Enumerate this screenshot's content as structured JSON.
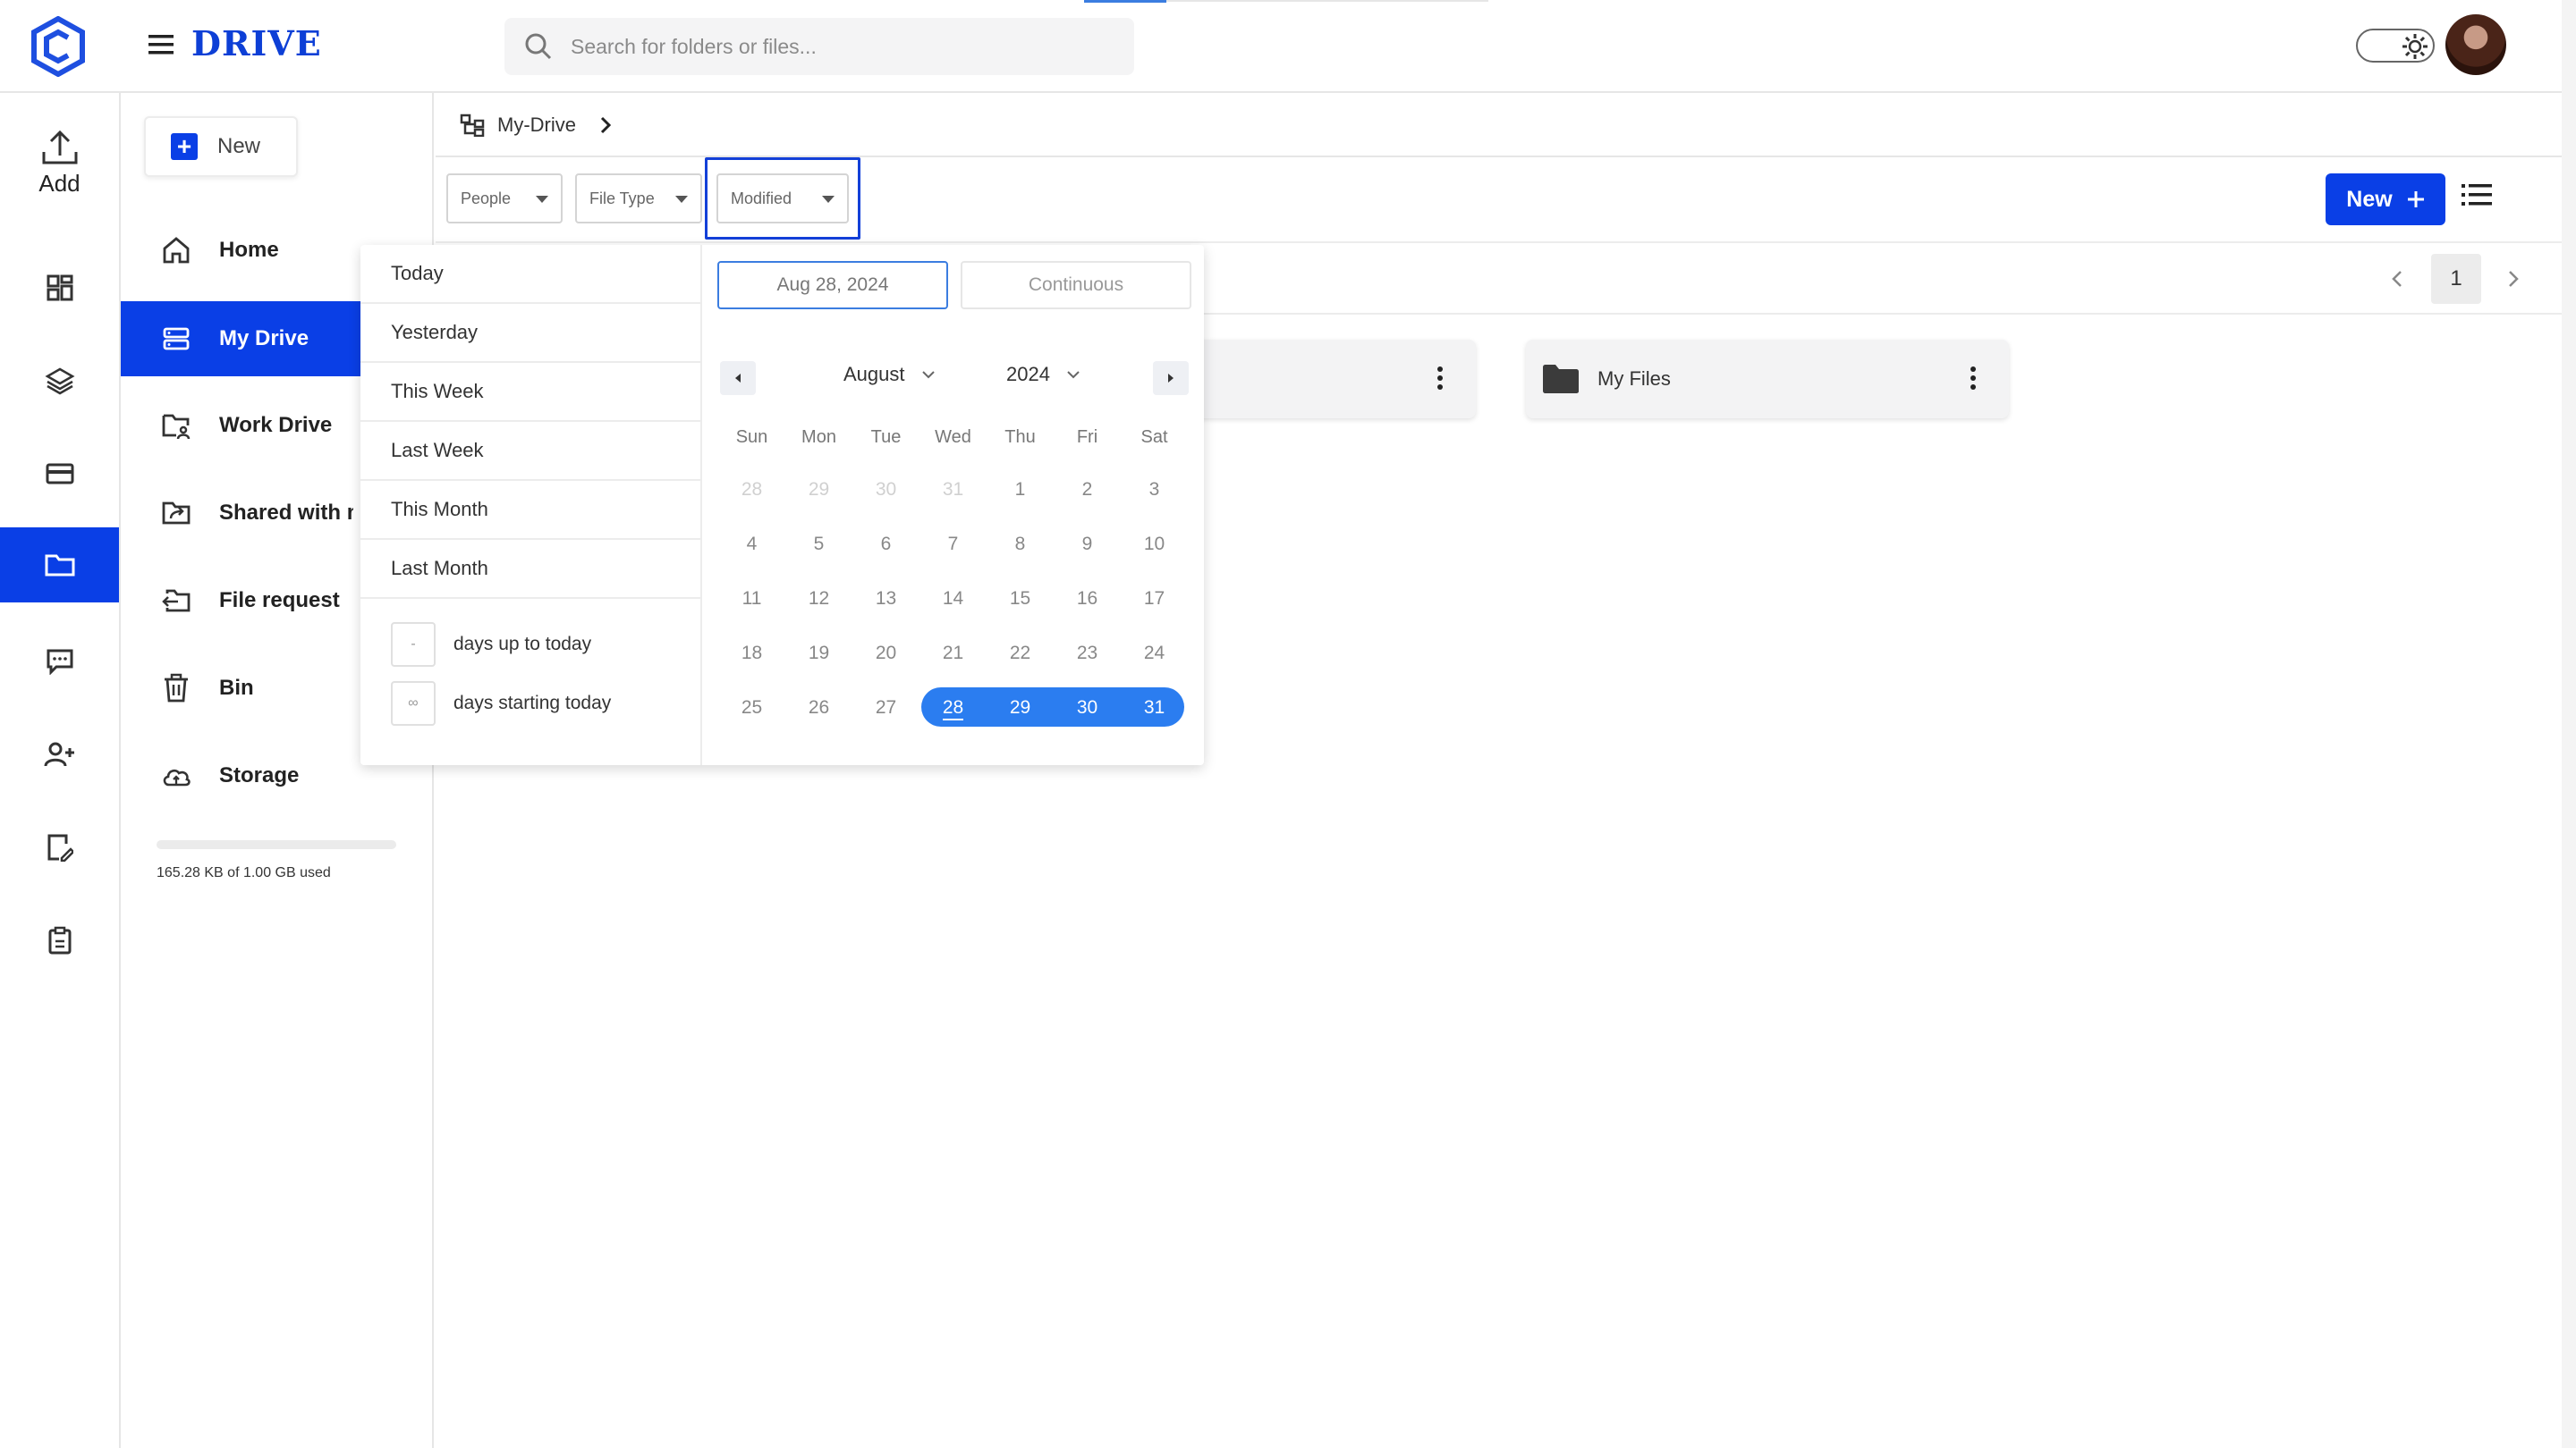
{
  "app": {
    "brand": "DRIVE"
  },
  "search": {
    "placeholder": "Search for folders or files..."
  },
  "rail": {
    "add_label": "Add"
  },
  "sidebar": {
    "new_label": "New",
    "items": [
      {
        "label": "Home"
      },
      {
        "label": "My Drive"
      },
      {
        "label": "Work Drive"
      },
      {
        "label": "Shared with me"
      },
      {
        "label": "File request"
      },
      {
        "label": "Bin"
      },
      {
        "label": "Storage"
      }
    ],
    "storage_text": "165.28 KB of 1.00 GB used",
    "storage_used_fraction": 0.0002
  },
  "breadcrumb": {
    "label": "My-Drive"
  },
  "filters": {
    "people": "People",
    "file_type": "File Type",
    "modified": "Modified"
  },
  "toolbar": {
    "new_label": "New"
  },
  "pagination": {
    "current": "1"
  },
  "folders": [
    {
      "name": ""
    },
    {
      "name": "My Files"
    }
  ],
  "date_filter": {
    "quick_options": [
      "Today",
      "Yesterday",
      "This Week",
      "Last Week",
      "This Month",
      "Last Month"
    ],
    "days_up_to_today": {
      "value": "-",
      "label": "days up to today"
    },
    "days_starting_today": {
      "value": "∞",
      "label": "days starting today"
    },
    "start_date": "Aug 28, 2024",
    "end_date": "Continuous",
    "month": "August",
    "year": "2024",
    "weekdays": [
      "Sun",
      "Mon",
      "Tue",
      "Wed",
      "Thu",
      "Fri",
      "Sat"
    ],
    "weeks": [
      [
        "28",
        "29",
        "30",
        "31",
        "1",
        "2",
        "3"
      ],
      [
        "4",
        "5",
        "6",
        "7",
        "8",
        "9",
        "10"
      ],
      [
        "11",
        "12",
        "13",
        "14",
        "15",
        "16",
        "17"
      ],
      [
        "18",
        "19",
        "20",
        "21",
        "22",
        "23",
        "24"
      ],
      [
        "25",
        "26",
        "27",
        "28",
        "29",
        "30",
        "31"
      ]
    ],
    "selected_range": [
      "28",
      "29",
      "30",
      "31"
    ]
  },
  "colors": {
    "primary": "#0a3fe6",
    "range": "#2b7df0",
    "brand_text": "#0d3fd6"
  }
}
